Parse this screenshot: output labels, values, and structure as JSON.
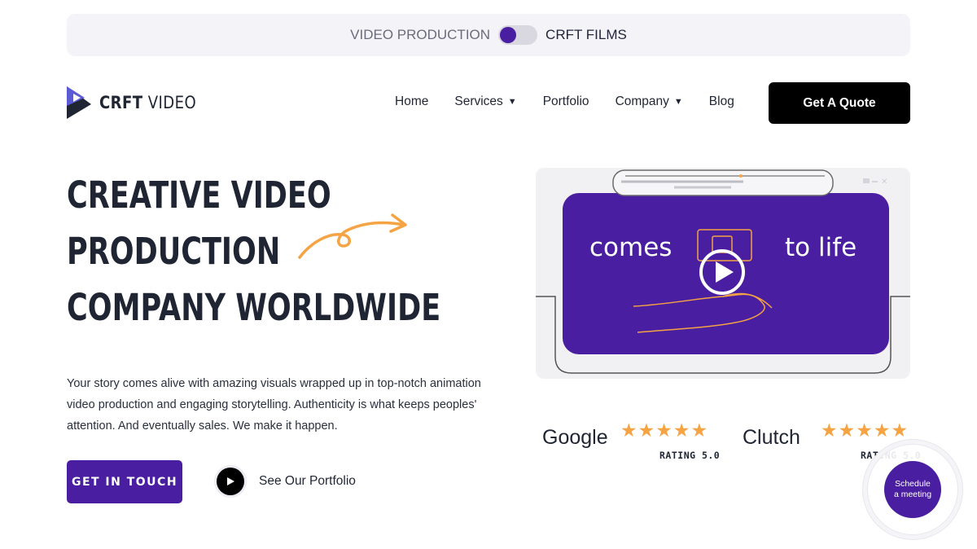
{
  "switcher": {
    "left_label": "VIDEO PRODUCTION",
    "right_label": "CRFT FILMS"
  },
  "logo": {
    "bold": "CRFT",
    "light": " VIDEO"
  },
  "nav": {
    "items": [
      {
        "label": "Home",
        "has_caret": false
      },
      {
        "label": "Services",
        "has_caret": true
      },
      {
        "label": "Portfolio",
        "has_caret": false
      },
      {
        "label": "Company",
        "has_caret": true
      },
      {
        "label": "Blog",
        "has_caret": false
      }
    ],
    "quote_button": "Get A Quote"
  },
  "hero": {
    "title_lines": [
      "CREATIVE VIDEO",
      "PRODUCTION",
      "COMPANY WORLDWIDE"
    ],
    "description": "Your story comes alive with amazing visuals wrapped up in top-notch animation video production and engaging storytelling. Authenticity is what keeps peoples' attention. And eventually sales. We make it happen.",
    "cta_button": "GET IN TOUCH",
    "portfolio_link": "See Our Portfolio"
  },
  "video": {
    "text_left": "comes",
    "text_right": "to life"
  },
  "ratings": [
    {
      "brand": "Google",
      "stars": "★★★★★",
      "label": "RATING 5.0"
    },
    {
      "brand": "Clutch",
      "stars": "★★★★★",
      "label": "RATING 5.0"
    }
  ],
  "schedule": {
    "line1": "Schedule",
    "line2": "a meeting"
  },
  "colors": {
    "accent_purple": "#4a1ea0",
    "star_orange": "#f5a343",
    "dark_text": "#1f2533"
  }
}
